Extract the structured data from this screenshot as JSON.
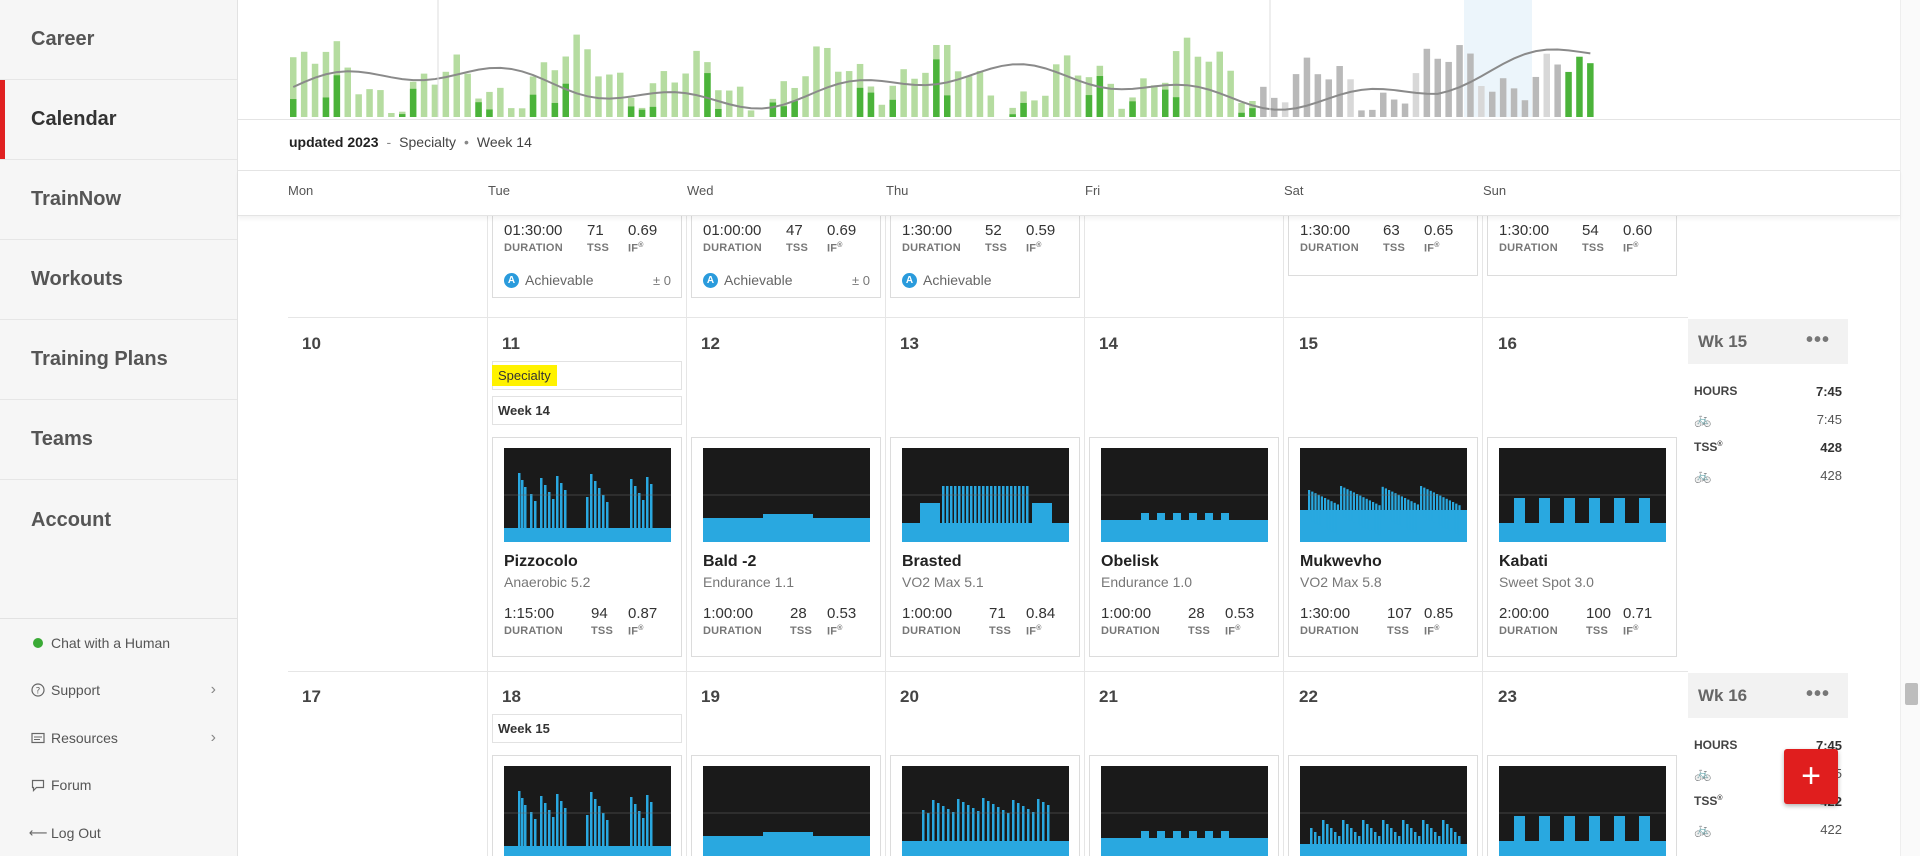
{
  "sidebar": {
    "items": [
      {
        "label": "Career"
      },
      {
        "label": "Calendar"
      },
      {
        "label": "TrainNow"
      },
      {
        "label": "Workouts"
      },
      {
        "label": "Training Plans"
      },
      {
        "label": "Teams"
      },
      {
        "label": "Account"
      }
    ],
    "active": "Calendar",
    "chat": "Chat with a Human",
    "support": "Support",
    "resources": "Resources",
    "forum": "Forum",
    "logout": "Log Out"
  },
  "breadcrumb": {
    "title": "updated 2023",
    "phase": "Specialty",
    "week": "Week 14"
  },
  "days": [
    "Mon",
    "Tue",
    "Wed",
    "Thu",
    "Fri",
    "Sat",
    "Sun"
  ],
  "top_row": [
    {
      "day": "Tue",
      "duration": "01:30:00",
      "tss": "71",
      "if": "0.69",
      "ach": "Achievable",
      "delta": "± 0"
    },
    {
      "day": "Wed",
      "duration": "01:00:00",
      "tss": "47",
      "if": "0.69",
      "ach": "Achievable",
      "delta": "± 0"
    },
    {
      "day": "Thu",
      "duration": "1:30:00",
      "tss": "52",
      "if": "0.59",
      "ach": "Achievable",
      "delta": ""
    },
    {
      "day": "Sat",
      "duration": "1:30:00",
      "tss": "63",
      "if": "0.65"
    },
    {
      "day": "Sun",
      "duration": "1:30:00",
      "tss": "54",
      "if": "0.60"
    }
  ],
  "labels": {
    "duration": "DURATION",
    "tss": "TSS",
    "if": "IF",
    "sup": "®"
  },
  "week2": {
    "dates": [
      "10",
      "11",
      "12",
      "13",
      "14",
      "15",
      "16"
    ],
    "phase_chip": "Specialty",
    "week_chip": "Week 14",
    "workouts": [
      {
        "name": "Pizzocolo",
        "type": "Anaerobic 5.2",
        "duration": "1:15:00",
        "tss": "94",
        "if": "0.87"
      },
      {
        "name": "Bald -2",
        "type": "Endurance 1.1",
        "duration": "1:00:00",
        "tss": "28",
        "if": "0.53"
      },
      {
        "name": "Brasted",
        "type": "VO2 Max 5.1",
        "duration": "1:00:00",
        "tss": "71",
        "if": "0.84"
      },
      {
        "name": "Obelisk",
        "type": "Endurance 1.0",
        "duration": "1:00:00",
        "tss": "28",
        "if": "0.53"
      },
      {
        "name": "Mukwevho",
        "type": "VO2 Max 5.8",
        "duration": "1:30:00",
        "tss": "107",
        "if": "0.85"
      },
      {
        "name": "Kabati",
        "type": "Sweet Spot 3.0",
        "duration": "2:00:00",
        "tss": "100",
        "if": "0.71"
      }
    ],
    "summary": {
      "title": "Wk 15",
      "hours_label": "HOURS",
      "hours": "7:45",
      "hours_bike": "7:45",
      "tss_label": "TSS",
      "tss": "428",
      "tss_bike": "428"
    }
  },
  "week3": {
    "dates": [
      "17",
      "18",
      "19",
      "20",
      "21",
      "22",
      "23"
    ],
    "week_chip": "Week 15",
    "summary": {
      "title": "Wk 16",
      "hours_label": "HOURS",
      "hours": "7:45",
      "hours_bike": "7:45",
      "tss_label": "TSS",
      "tss": "422",
      "tss_bike": "422"
    }
  },
  "fab": "+",
  "colors": {
    "accent": "#e02020",
    "workout_blue": "#29a8e0",
    "done_green": "#4bb33a",
    "planned_green": "#b5dca0",
    "future_gray": "#b9b9b9"
  },
  "icons": {
    "bike": "bicycle-icon",
    "more": "more-icon",
    "support": "question-icon",
    "resources": "folder-icon",
    "forum": "chat-icon",
    "logout": "arrow-left-icon"
  }
}
